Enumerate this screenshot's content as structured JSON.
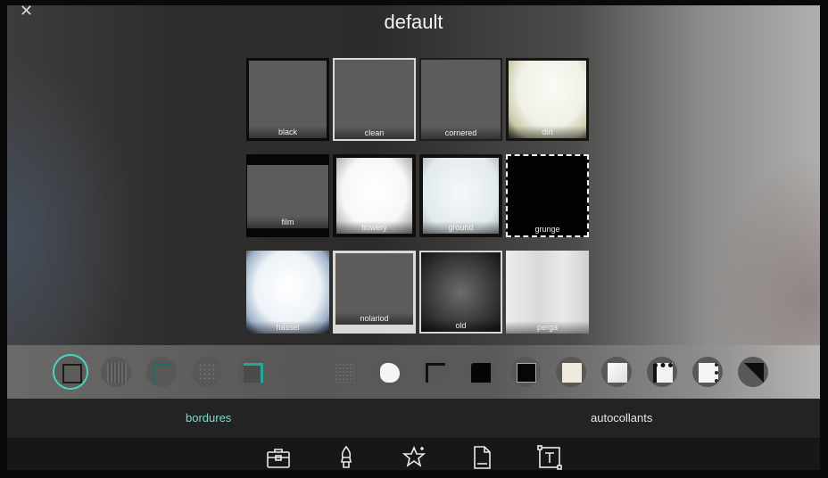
{
  "title": "default",
  "close_glyph": "✕",
  "frames": [
    {
      "label": "black",
      "style": "f-black"
    },
    {
      "label": "clean",
      "style": "f-clean"
    },
    {
      "label": "cornered",
      "style": "f-cornered"
    },
    {
      "label": "dirt",
      "style": "f-dirt"
    },
    {
      "label": "film",
      "style": "f-film"
    },
    {
      "label": "flowery",
      "style": "f-flowery"
    },
    {
      "label": "ground",
      "style": "f-ground"
    },
    {
      "label": "grunge",
      "style": "f-grunge"
    },
    {
      "label": "hassel",
      "style": "f-hassel"
    },
    {
      "label": "nolariod",
      "style": "f-nolariod"
    },
    {
      "label": "old",
      "style": "f-old"
    },
    {
      "label": "perga",
      "style": "f-perga"
    }
  ],
  "category_thumbs": [
    {
      "icon": "square-frame-icon",
      "selected": true
    },
    {
      "icon": "dotted-texture-icon"
    },
    {
      "icon": "corner-frame-icon"
    },
    {
      "icon": "speckle-icon"
    },
    {
      "icon": "teal-corner-icon"
    },
    {
      "icon": "plain-circle-icon"
    },
    {
      "icon": "grain-icon"
    },
    {
      "icon": "white-blob-icon"
    },
    {
      "icon": "dark-square-icon"
    },
    {
      "icon": "black-square-icon"
    },
    {
      "icon": "black-frame-icon"
    },
    {
      "icon": "cream-square-icon"
    },
    {
      "icon": "white-square-icon"
    },
    {
      "icon": "film-strip-icon"
    },
    {
      "icon": "grunge-white-icon"
    },
    {
      "icon": "half-dark-icon"
    }
  ],
  "tabs": {
    "bordures": "bordures",
    "autocollants": "autocollants",
    "active": "bordures"
  },
  "colors": {
    "accent": "#48d4c6",
    "active_tab": "#7fd8cf"
  },
  "toolbar_icons": [
    "toolbox-icon",
    "brush-icon",
    "magic-star-icon",
    "document-icon",
    "text-frame-icon"
  ]
}
